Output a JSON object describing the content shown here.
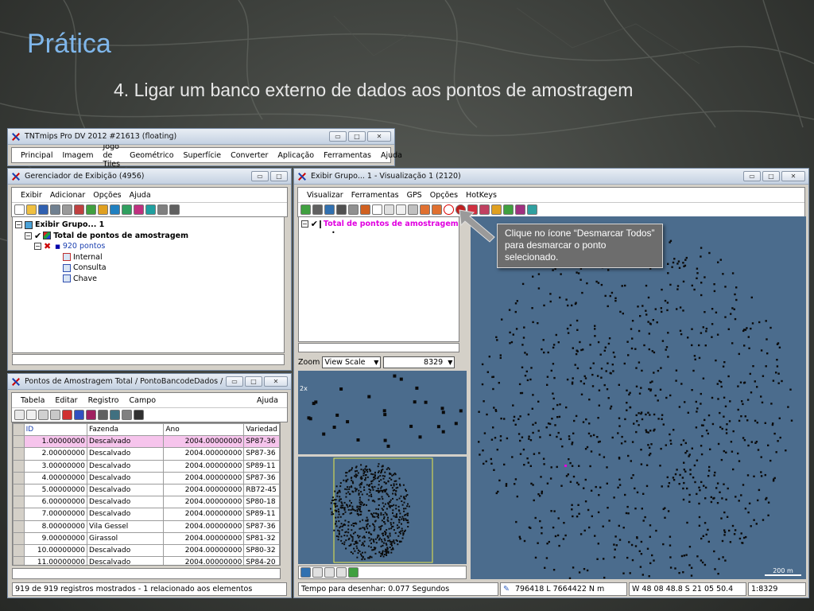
{
  "slide": {
    "title": "Prática",
    "subtitle": "4. Ligar um banco externo de dados aos pontos de amostragem"
  },
  "main_window": {
    "title": "TNTmips Pro DV 2012  #21613 (floating)",
    "menu": [
      "Principal",
      "Imagem",
      "Jogo de Tiles",
      "Geométrico",
      "Superfície",
      "Converter",
      "Aplicação",
      "Ferramentas",
      "Ajuda"
    ]
  },
  "display_manager": {
    "title": "Gerenciador de Exibição (4956)",
    "menu": [
      "Exibir",
      "Adicionar",
      "Opções",
      "Ajuda"
    ],
    "tree": {
      "group": "Exibir Grupo... 1",
      "layer": "Total de pontos de amostragem",
      "points": "920 pontos",
      "tables": [
        "Internal",
        "Consulta",
        "Chave"
      ]
    }
  },
  "table_window": {
    "title": "Pontos de Amostragem Total / PontoBancodeDados / Consu...",
    "menu_left": [
      "Tabela",
      "Editar",
      "Registro",
      "Campo"
    ],
    "menu_right": "Ajuda",
    "columns": [
      "ID",
      "Fazenda",
      "Ano",
      "Variedad"
    ],
    "rows": [
      [
        "1.00000000",
        "Descalvado",
        "2004.00000000",
        "SP87-36"
      ],
      [
        "2.00000000",
        "Descalvado",
        "2004.00000000",
        "SP87-36"
      ],
      [
        "3.00000000",
        "Descalvado",
        "2004.00000000",
        "SP89-11"
      ],
      [
        "4.00000000",
        "Descalvado",
        "2004.00000000",
        "SP87-36"
      ],
      [
        "5.00000000",
        "Descalvado",
        "2004.00000000",
        "RB72-45"
      ],
      [
        "6.00000000",
        "Descalvado",
        "2004.00000000",
        "SP80-18"
      ],
      [
        "7.00000000",
        "Descalvado",
        "2004.00000000",
        "SP89-11"
      ],
      [
        "8.00000000",
        "Vila Gessel",
        "2004.00000000",
        "SP87-36"
      ],
      [
        "9.00000000",
        "Girassol",
        "2004.00000000",
        "SP81-32"
      ],
      [
        "10.00000000",
        "Descalvado",
        "2004.00000000",
        "SP80-32"
      ],
      [
        "11.00000000",
        "Descalvado",
        "2004.00000000",
        "SP84-20"
      ]
    ],
    "status": "919 de 919 registros mostrados - 1 relacionado aos elementos"
  },
  "view_window": {
    "title": "Exibir Grupo... 1 - Visualização 1 (2120)",
    "menu": [
      "Visualizar",
      "Ferramentas",
      "GPS",
      "Opções",
      "HotKeys"
    ],
    "legend_layer": "Total de pontos de amostragem",
    "zoom_label": "Zoom",
    "zoom_mode": "View Scale",
    "zoom_value": "8329",
    "scale_bar": "200 m",
    "status_time": "Tempo para desenhar: 0.077 Segundos",
    "status_coords": "796418 L  7664422 N m",
    "status_latlon": "W 48 08 48.8  S 21 05 50.4",
    "status_scale": "1:8329",
    "magnifier_label": "2x"
  },
  "tooltip": {
    "text": "Clique no ícone “Desmarcar Todos” para desmarcar o ponto selecionado."
  },
  "colors": {
    "title_blue": "#7fb6ea",
    "map_background": "#4b6c8d",
    "layer_label": "#e000e0",
    "selected_row": "#f6c4ec"
  }
}
